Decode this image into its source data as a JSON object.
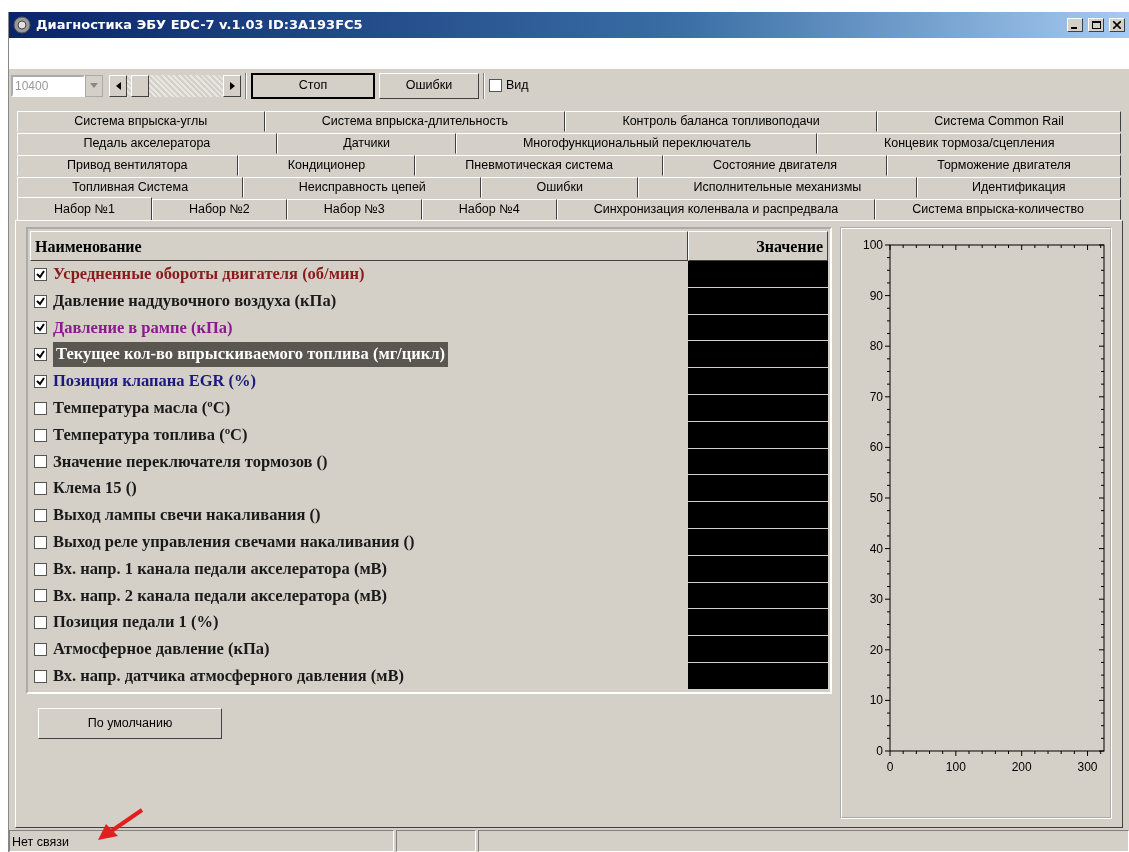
{
  "window": {
    "title": "Диагностика ЭБУ EDC-7 v.1.03 ID:3A193FC5"
  },
  "toolbar": {
    "port_speed": {
      "value": "10400",
      "disabled": true
    },
    "buttons": [
      {
        "label": "Стоп",
        "pressed": true
      },
      {
        "label": "Ошибки",
        "pressed": false
      }
    ],
    "view_checkbox": {
      "label": "Вид",
      "checked": false
    }
  },
  "tab_rows": [
    {
      "tabs": [
        {
          "label": "Система впрыска-углы",
          "selected": false
        },
        {
          "label": "Система впрыска-длительность",
          "selected": false
        },
        {
          "label": "Контроль баланса топливоподачи",
          "selected": false
        },
        {
          "label": "Система Common Rail",
          "selected": false
        }
      ]
    },
    {
      "tabs": [
        {
          "label": "Педаль акселератора",
          "selected": false
        },
        {
          "label": "Датчики",
          "selected": false
        },
        {
          "label": "Многофункциональный переключатель",
          "selected": false
        },
        {
          "label": "Концевик тормоза/сцепления",
          "selected": false
        }
      ]
    },
    {
      "tabs": [
        {
          "label": "Привод вентилятора",
          "selected": false
        },
        {
          "label": "Кондиционер",
          "selected": false
        },
        {
          "label": "Пневмотическая система",
          "selected": false
        },
        {
          "label": "Состояние двигателя",
          "selected": false
        },
        {
          "label": "Торможение двигателя",
          "selected": false
        }
      ]
    },
    {
      "tabs": [
        {
          "label": "Топливная Система",
          "selected": false
        },
        {
          "label": "Неисправность цепей",
          "selected": false
        },
        {
          "label": "Ошибки",
          "selected": false
        },
        {
          "label": "Исполнительные механизмы",
          "selected": false
        },
        {
          "label": "Идентификация",
          "selected": false
        }
      ]
    },
    {
      "tabs": [
        {
          "label": "Набор №1",
          "selected": true
        },
        {
          "label": "Набор №2",
          "selected": false
        },
        {
          "label": "Набор №3",
          "selected": false
        },
        {
          "label": "Набор №4",
          "selected": false
        },
        {
          "label": "Синхронизация коленвала и распредвала",
          "selected": false
        },
        {
          "label": "Система впрыска-количество",
          "selected": false
        }
      ]
    }
  ],
  "table": {
    "columns": [
      "Наименование",
      "Значение"
    ],
    "rows": [
      {
        "name": "Усредненные обороты двигателя (об/мин)",
        "checked": true,
        "color": "#8b1a1a"
      },
      {
        "name": "Давление наддувочного воздуха (кПа)",
        "checked": true,
        "color": "#1a1a1a"
      },
      {
        "name": "Давление в рампе (кПа)",
        "checked": true,
        "color": "#8b1a8b"
      },
      {
        "name": "Текущее кол-во впрыскиваемого топлива (мг/цикл)",
        "checked": true,
        "color": "#ffffff"
      },
      {
        "name": "Позиция клапана EGR (%)",
        "checked": true,
        "color": "#1a1a80"
      },
      {
        "name": "Температура масла (ºC)",
        "checked": false,
        "color": "#1a1a1a"
      },
      {
        "name": "Температура топлива (ºC)",
        "checked": false,
        "color": "#1a1a1a"
      },
      {
        "name": "Значение переключателя тормозов ()",
        "checked": false,
        "color": "#1a1a1a"
      },
      {
        "name": "Клема 15 ()",
        "checked": false,
        "color": "#1a1a1a"
      },
      {
        "name": "Выход лампы свечи накаливания ()",
        "checked": false,
        "color": "#1a1a1a"
      },
      {
        "name": "Выход реле управления свечами накаливания ()",
        "checked": false,
        "color": "#1a1a1a"
      },
      {
        "name": "Вх. напр. 1 канала педали акселератора (мВ)",
        "checked": false,
        "color": "#1a1a1a"
      },
      {
        "name": "Вх. напр. 2 канала педали акселератора (мВ)",
        "checked": false,
        "color": "#1a1a1a"
      },
      {
        "name": "Позиция педали 1 (%)",
        "checked": false,
        "color": "#1a1a1a"
      },
      {
        "name": "Атмосферное давление (кПа)",
        "checked": false,
        "color": "#1a1a1a"
      },
      {
        "name": "Вх. напр. датчика атмосферного давления (мВ)",
        "checked": false,
        "color": "#1a1a1a"
      }
    ]
  },
  "default_button": {
    "label": "По умолчанию"
  },
  "chart": {
    "chart_data": {
      "type": "line",
      "xlim": [
        0,
        325
      ],
      "ylim": [
        0,
        100
      ],
      "xticks": [
        0,
        100,
        200,
        300
      ],
      "yticks": [
        0,
        10,
        20,
        30,
        40,
        50,
        60,
        70,
        80,
        90,
        100
      ]
    }
  },
  "status_bar": {
    "text": "Нет связи"
  }
}
